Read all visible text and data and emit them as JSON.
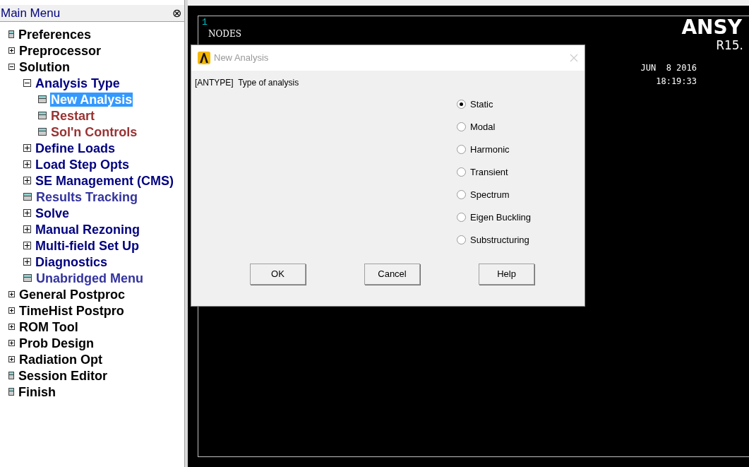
{
  "main_menu": {
    "title": "Main Menu",
    "collapse_icon": "⊗",
    "items": [
      {
        "label": "Preferences",
        "kind": "action",
        "selected": false,
        "color": "#000000"
      },
      {
        "label": "Preprocessor",
        "kind": "folder",
        "expanded": false,
        "selected": false,
        "color": "#000000"
      },
      {
        "label": "Solution",
        "kind": "folder",
        "expanded": true,
        "selected": false,
        "color": "#000000",
        "children": [
          {
            "label": "Analysis Type",
            "kind": "folder",
            "expanded": true,
            "selected": false,
            "color": "#000080",
            "children": [
              {
                "label": "New Analysis",
                "kind": "action",
                "selected": true
              },
              {
                "label": "Restart",
                "kind": "action",
                "selected": false,
                "color": "#993333"
              },
              {
                "label": "Sol'n Controls",
                "kind": "action",
                "selected": false,
                "color": "#993333"
              }
            ]
          },
          {
            "label": "Define Loads",
            "kind": "folder",
            "expanded": false,
            "selected": false,
            "color": "#000080"
          },
          {
            "label": "Load Step Opts",
            "kind": "folder",
            "expanded": false,
            "selected": false,
            "color": "#000080"
          },
          {
            "label": "SE Management (CMS)",
            "kind": "folder",
            "expanded": false,
            "selected": false,
            "color": "#000080"
          },
          {
            "label": "Results Tracking",
            "kind": "action",
            "selected": false,
            "color": "#3333a0"
          },
          {
            "label": "Solve",
            "kind": "folder",
            "expanded": false,
            "selected": false,
            "color": "#000080"
          },
          {
            "label": "Manual Rezoning",
            "kind": "folder",
            "expanded": false,
            "selected": false,
            "color": "#000080"
          },
          {
            "label": "Multi-field Set Up",
            "kind": "folder",
            "expanded": false,
            "selected": false,
            "color": "#000080"
          },
          {
            "label": "Diagnostics",
            "kind": "folder",
            "expanded": false,
            "selected": false,
            "color": "#000080"
          },
          {
            "label": "Unabridged Menu",
            "kind": "action",
            "selected": false,
            "color": "#3333a0"
          }
        ]
      },
      {
        "label": "General Postproc",
        "kind": "folder",
        "expanded": false,
        "selected": false,
        "color": "#000000"
      },
      {
        "label": "TimeHist Postpro",
        "kind": "folder",
        "expanded": false,
        "selected": false,
        "color": "#000000"
      },
      {
        "label": "ROM Tool",
        "kind": "folder",
        "expanded": false,
        "selected": false,
        "color": "#000000"
      },
      {
        "label": "Prob Design",
        "kind": "folder",
        "expanded": false,
        "selected": false,
        "color": "#000000"
      },
      {
        "label": "Radiation Opt",
        "kind": "folder",
        "expanded": false,
        "selected": false,
        "color": "#000000"
      },
      {
        "label": "Session Editor",
        "kind": "action",
        "selected": false,
        "color": "#000000"
      },
      {
        "label": "Finish",
        "kind": "action",
        "selected": false,
        "color": "#000000"
      }
    ]
  },
  "graphics": {
    "window_number": "1",
    "plot_label": "NODES",
    "product": "ANSY",
    "release": "R15.",
    "date": "JUN  8 2016",
    "time": "18:19:33"
  },
  "dialog": {
    "title": "New Analysis",
    "prompt": "[ANTYPE]  Type of analysis",
    "options": [
      {
        "label": "Static",
        "selected": true
      },
      {
        "label": "Modal",
        "selected": false
      },
      {
        "label": "Harmonic",
        "selected": false
      },
      {
        "label": "Transient",
        "selected": false
      },
      {
        "label": "Spectrum",
        "selected": false
      },
      {
        "label": "Eigen Buckling",
        "selected": false
      },
      {
        "label": "Substructuring",
        "selected": false
      }
    ],
    "buttons": [
      "OK",
      "Cancel",
      "Help"
    ]
  }
}
